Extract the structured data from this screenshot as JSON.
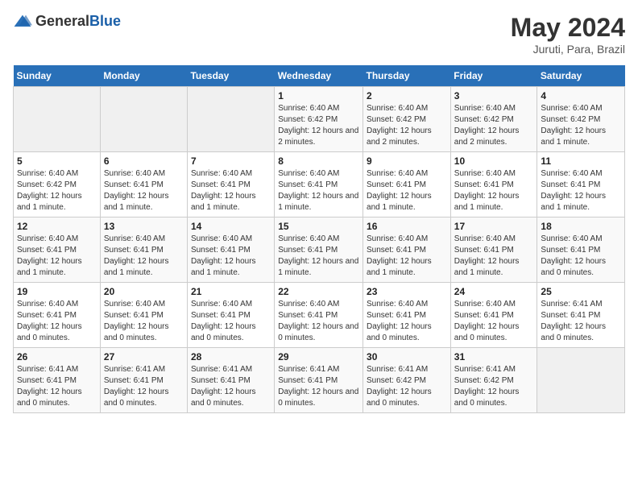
{
  "header": {
    "logo_general": "General",
    "logo_blue": "Blue",
    "month_year": "May 2024",
    "location": "Juruti, Para, Brazil"
  },
  "weekdays": [
    "Sunday",
    "Monday",
    "Tuesday",
    "Wednesday",
    "Thursday",
    "Friday",
    "Saturday"
  ],
  "weeks": [
    [
      {
        "day": "",
        "info": ""
      },
      {
        "day": "",
        "info": ""
      },
      {
        "day": "",
        "info": ""
      },
      {
        "day": "1",
        "info": "Sunrise: 6:40 AM\nSunset: 6:42 PM\nDaylight: 12 hours and 2 minutes."
      },
      {
        "day": "2",
        "info": "Sunrise: 6:40 AM\nSunset: 6:42 PM\nDaylight: 12 hours and 2 minutes."
      },
      {
        "day": "3",
        "info": "Sunrise: 6:40 AM\nSunset: 6:42 PM\nDaylight: 12 hours and 2 minutes."
      },
      {
        "day": "4",
        "info": "Sunrise: 6:40 AM\nSunset: 6:42 PM\nDaylight: 12 hours and 1 minute."
      }
    ],
    [
      {
        "day": "5",
        "info": "Sunrise: 6:40 AM\nSunset: 6:42 PM\nDaylight: 12 hours and 1 minute."
      },
      {
        "day": "6",
        "info": "Sunrise: 6:40 AM\nSunset: 6:41 PM\nDaylight: 12 hours and 1 minute."
      },
      {
        "day": "7",
        "info": "Sunrise: 6:40 AM\nSunset: 6:41 PM\nDaylight: 12 hours and 1 minute."
      },
      {
        "day": "8",
        "info": "Sunrise: 6:40 AM\nSunset: 6:41 PM\nDaylight: 12 hours and 1 minute."
      },
      {
        "day": "9",
        "info": "Sunrise: 6:40 AM\nSunset: 6:41 PM\nDaylight: 12 hours and 1 minute."
      },
      {
        "day": "10",
        "info": "Sunrise: 6:40 AM\nSunset: 6:41 PM\nDaylight: 12 hours and 1 minute."
      },
      {
        "day": "11",
        "info": "Sunrise: 6:40 AM\nSunset: 6:41 PM\nDaylight: 12 hours and 1 minute."
      }
    ],
    [
      {
        "day": "12",
        "info": "Sunrise: 6:40 AM\nSunset: 6:41 PM\nDaylight: 12 hours and 1 minute."
      },
      {
        "day": "13",
        "info": "Sunrise: 6:40 AM\nSunset: 6:41 PM\nDaylight: 12 hours and 1 minute."
      },
      {
        "day": "14",
        "info": "Sunrise: 6:40 AM\nSunset: 6:41 PM\nDaylight: 12 hours and 1 minute."
      },
      {
        "day": "15",
        "info": "Sunrise: 6:40 AM\nSunset: 6:41 PM\nDaylight: 12 hours and 1 minute."
      },
      {
        "day": "16",
        "info": "Sunrise: 6:40 AM\nSunset: 6:41 PM\nDaylight: 12 hours and 1 minute."
      },
      {
        "day": "17",
        "info": "Sunrise: 6:40 AM\nSunset: 6:41 PM\nDaylight: 12 hours and 1 minute."
      },
      {
        "day": "18",
        "info": "Sunrise: 6:40 AM\nSunset: 6:41 PM\nDaylight: 12 hours and 0 minutes."
      }
    ],
    [
      {
        "day": "19",
        "info": "Sunrise: 6:40 AM\nSunset: 6:41 PM\nDaylight: 12 hours and 0 minutes."
      },
      {
        "day": "20",
        "info": "Sunrise: 6:40 AM\nSunset: 6:41 PM\nDaylight: 12 hours and 0 minutes."
      },
      {
        "day": "21",
        "info": "Sunrise: 6:40 AM\nSunset: 6:41 PM\nDaylight: 12 hours and 0 minutes."
      },
      {
        "day": "22",
        "info": "Sunrise: 6:40 AM\nSunset: 6:41 PM\nDaylight: 12 hours and 0 minutes."
      },
      {
        "day": "23",
        "info": "Sunrise: 6:40 AM\nSunset: 6:41 PM\nDaylight: 12 hours and 0 minutes."
      },
      {
        "day": "24",
        "info": "Sunrise: 6:40 AM\nSunset: 6:41 PM\nDaylight: 12 hours and 0 minutes."
      },
      {
        "day": "25",
        "info": "Sunrise: 6:41 AM\nSunset: 6:41 PM\nDaylight: 12 hours and 0 minutes."
      }
    ],
    [
      {
        "day": "26",
        "info": "Sunrise: 6:41 AM\nSunset: 6:41 PM\nDaylight: 12 hours and 0 minutes."
      },
      {
        "day": "27",
        "info": "Sunrise: 6:41 AM\nSunset: 6:41 PM\nDaylight: 12 hours and 0 minutes."
      },
      {
        "day": "28",
        "info": "Sunrise: 6:41 AM\nSunset: 6:41 PM\nDaylight: 12 hours and 0 minutes."
      },
      {
        "day": "29",
        "info": "Sunrise: 6:41 AM\nSunset: 6:41 PM\nDaylight: 12 hours and 0 minutes."
      },
      {
        "day": "30",
        "info": "Sunrise: 6:41 AM\nSunset: 6:42 PM\nDaylight: 12 hours and 0 minutes."
      },
      {
        "day": "31",
        "info": "Sunrise: 6:41 AM\nSunset: 6:42 PM\nDaylight: 12 hours and 0 minutes."
      },
      {
        "day": "",
        "info": ""
      }
    ]
  ]
}
